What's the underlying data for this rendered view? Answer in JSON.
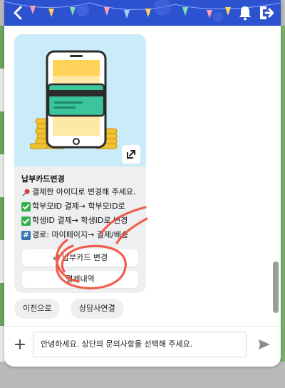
{
  "colors": {
    "header": "#2c52cf",
    "card": "#eeeff1",
    "image_bg": "#c9ecf8",
    "annotation": "#f04e3a"
  },
  "header": {
    "back_icon": "chevron-left-icon",
    "bell_icon": "bell-icon",
    "logout_icon": "logout-icon"
  },
  "card": {
    "title": "납부카드변경",
    "lines": [
      {
        "icon": "pin",
        "text": "결제한 아이디로 변경해 주세요."
      },
      {
        "icon": "check",
        "text": "학부모ID 결제→ 학부모ID로"
      },
      {
        "icon": "check",
        "text": "학생ID 결제→ 학생ID로 변경"
      },
      {
        "icon": "hash",
        "text": "경로: 마이페이지→ 결제/배송"
      }
    ],
    "buttons": [
      {
        "label": "납부카드 변경",
        "icon": "link-icon"
      },
      {
        "label": "결제내역"
      }
    ]
  },
  "quick_replies": [
    "이전으로",
    "상담사연결"
  ],
  "input": {
    "value": "안녕하세요. 상단의 문의사항을 선택해 주세요."
  }
}
